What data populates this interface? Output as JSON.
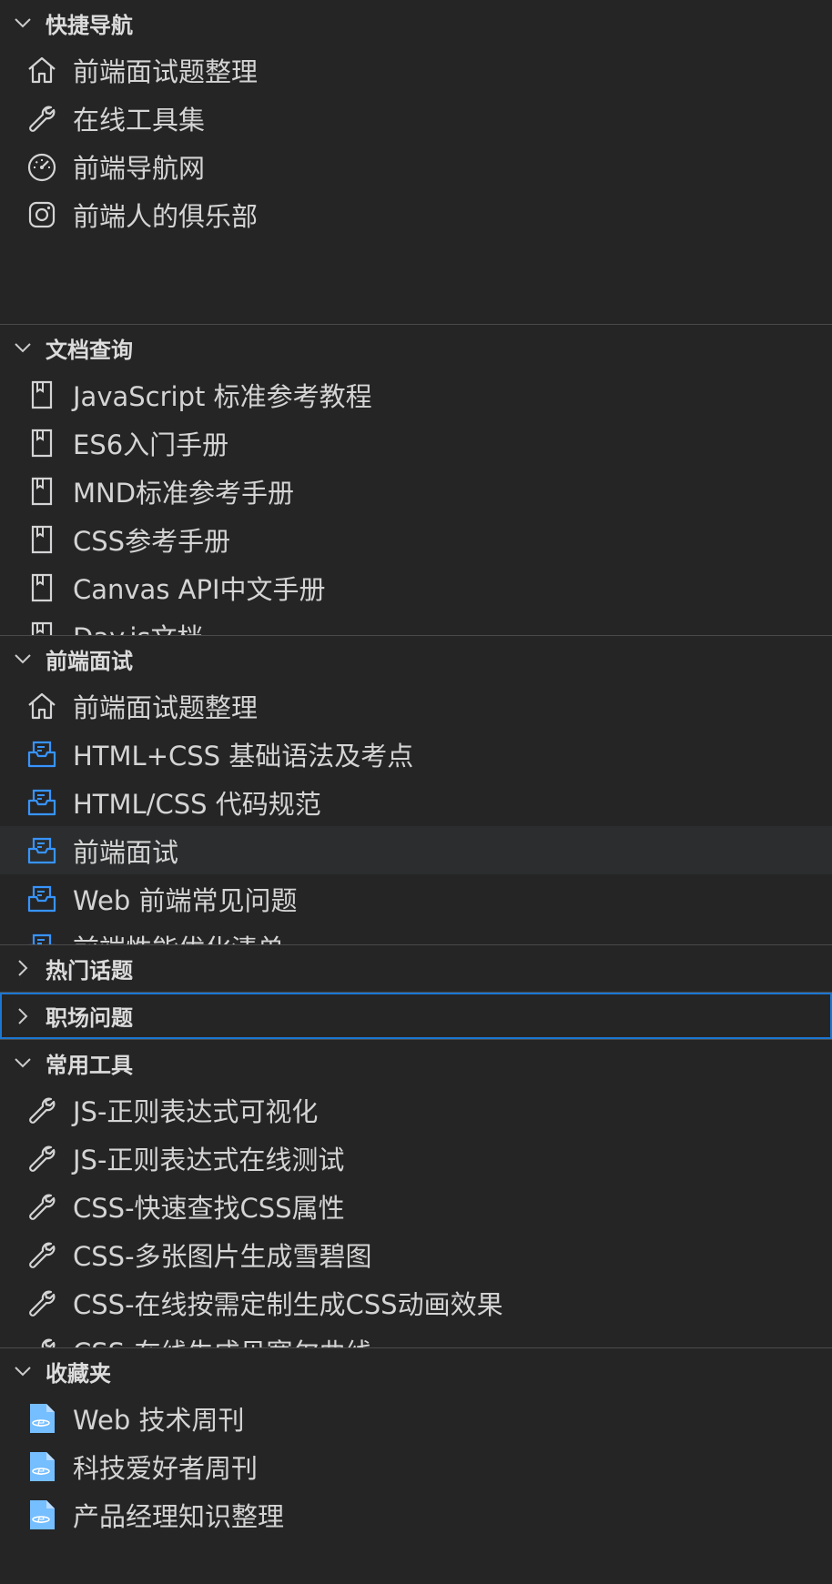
{
  "sections": [
    {
      "title": "快捷导航",
      "expanded": true,
      "items": [
        {
          "label": "前端面试题整理",
          "icon": "home-icon"
        },
        {
          "label": "在线工具集",
          "icon": "wrench-icon"
        },
        {
          "label": "前端导航网",
          "icon": "dashboard-icon"
        },
        {
          "label": "前端人的俱乐部",
          "icon": "instagram-icon"
        }
      ]
    },
    {
      "title": "文档查询",
      "expanded": true,
      "items": [
        {
          "label": "JavaScript 标准参考教程",
          "icon": "book-icon"
        },
        {
          "label": "ES6入门手册",
          "icon": "book-icon"
        },
        {
          "label": "MND标准参考手册",
          "icon": "book-icon"
        },
        {
          "label": "CSS参考手册",
          "icon": "book-icon"
        },
        {
          "label": "Canvas API中文手册",
          "icon": "book-icon"
        },
        {
          "label": "Day.js文档",
          "icon": "book-icon"
        }
      ]
    },
    {
      "title": "前端面试",
      "expanded": true,
      "items": [
        {
          "label": "前端面试题整理",
          "icon": "home-icon"
        },
        {
          "label": "HTML+CSS 基础语法及考点",
          "icon": "inbox-icon"
        },
        {
          "label": "HTML/CSS 代码规范",
          "icon": "inbox-icon"
        },
        {
          "label": "前端面试",
          "icon": "inbox-icon"
        },
        {
          "label": "Web 前端常见问题",
          "icon": "inbox-icon"
        },
        {
          "label": "前端性能优化清单",
          "icon": "inbox-icon"
        }
      ]
    },
    {
      "title": "热门话题",
      "expanded": false,
      "items": []
    },
    {
      "title": "职场问题",
      "expanded": false,
      "items": []
    },
    {
      "title": "常用工具",
      "expanded": true,
      "items": [
        {
          "label": "JS-正则表达式可视化",
          "icon": "wrench-icon"
        },
        {
          "label": "JS-正则表达式在线测试",
          "icon": "wrench-icon"
        },
        {
          "label": "CSS-快速查找CSS属性",
          "icon": "wrench-icon"
        },
        {
          "label": "CSS-多张图片生成雪碧图",
          "icon": "wrench-icon"
        },
        {
          "label": "CSS-在线按需定制生成CSS动画效果",
          "icon": "wrench-icon"
        },
        {
          "label": "CSS-在线生成贝塞尔曲线",
          "icon": "wrench-icon"
        }
      ]
    },
    {
      "title": "收藏夹",
      "expanded": true,
      "items": [
        {
          "label": "Web 技术周刊",
          "icon": "web-file-icon"
        },
        {
          "label": "科技爱好者周刊",
          "icon": "web-file-icon"
        },
        {
          "label": "产品经理知识整理",
          "icon": "web-file-icon"
        }
      ]
    }
  ],
  "colors": {
    "background": "#252526",
    "text": "#d4d4d4",
    "focus_border": "#1b77d2",
    "inbox_icon": "#3794ff",
    "web_file_icon": "#75beff"
  }
}
